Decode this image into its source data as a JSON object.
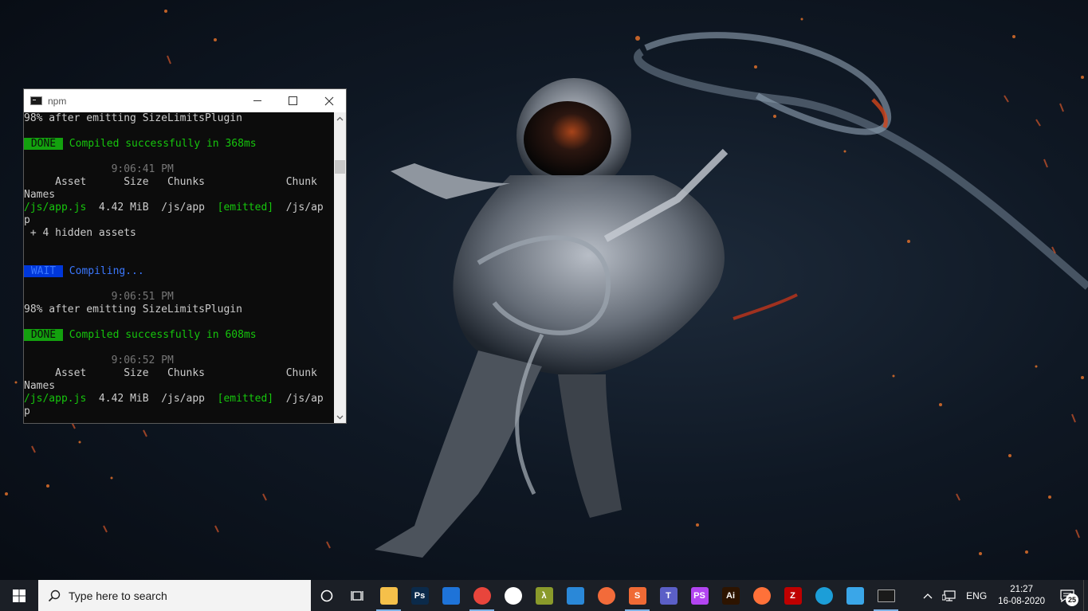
{
  "console_window": {
    "title": "npm",
    "lines": [
      {
        "parts": [
          {
            "text": "98% after emitting SizeLimitsPlugin",
            "cls": ""
          }
        ]
      },
      {
        "parts": []
      },
      {
        "parts": [
          {
            "text": " DONE ",
            "cls": "tag-done"
          },
          {
            "text": " Compiled successfully in 368ms",
            "cls": "green"
          }
        ]
      },
      {
        "parts": []
      },
      {
        "parts": [
          {
            "text": "              9:06:41 PM",
            "cls": "grey"
          }
        ]
      },
      {
        "parts": [
          {
            "text": "     Asset      Size   Chunks             Chunk",
            "cls": ""
          }
        ]
      },
      {
        "parts": [
          {
            "text": "Names",
            "cls": ""
          }
        ]
      },
      {
        "parts": [
          {
            "text": "/js/app.js",
            "cls": "green"
          },
          {
            "text": "  4.42 MiB  /js/app  ",
            "cls": ""
          },
          {
            "text": "[emitted]",
            "cls": "green"
          },
          {
            "text": "  /js/ap",
            "cls": ""
          }
        ]
      },
      {
        "parts": [
          {
            "text": "p",
            "cls": ""
          }
        ]
      },
      {
        "parts": [
          {
            "text": " + 4 hidden assets",
            "cls": ""
          }
        ]
      },
      {
        "parts": []
      },
      {
        "parts": []
      },
      {
        "parts": [
          {
            "text": " WAIT ",
            "cls": "tag-wait"
          },
          {
            "text": " Compiling...",
            "cls": "blue"
          }
        ]
      },
      {
        "parts": []
      },
      {
        "parts": [
          {
            "text": "              9:06:51 PM",
            "cls": "grey"
          }
        ]
      },
      {
        "parts": [
          {
            "text": "98% after emitting SizeLimitsPlugin",
            "cls": ""
          }
        ]
      },
      {
        "parts": []
      },
      {
        "parts": [
          {
            "text": " DONE ",
            "cls": "tag-done"
          },
          {
            "text": " Compiled successfully in 608ms",
            "cls": "green"
          }
        ]
      },
      {
        "parts": []
      },
      {
        "parts": [
          {
            "text": "              9:06:52 PM",
            "cls": "grey"
          }
        ]
      },
      {
        "parts": [
          {
            "text": "     Asset      Size   Chunks             Chunk",
            "cls": ""
          }
        ]
      },
      {
        "parts": [
          {
            "text": "Names",
            "cls": ""
          }
        ]
      },
      {
        "parts": [
          {
            "text": "/js/app.js",
            "cls": "green"
          },
          {
            "text": "  4.42 MiB  /js/app  ",
            "cls": ""
          },
          {
            "text": "[emitted]",
            "cls": "green"
          },
          {
            "text": "  /js/ap",
            "cls": ""
          }
        ]
      },
      {
        "parts": [
          {
            "text": "p",
            "cls": ""
          }
        ]
      }
    ]
  },
  "taskbar": {
    "search_placeholder": "Type here to search",
    "apps": [
      {
        "name": "file-explorer-icon",
        "label": "",
        "color": "#f5c04a",
        "state": "running"
      },
      {
        "name": "photoshop-icon",
        "label": "Ps",
        "color": "#0b2a4a",
        "state": ""
      },
      {
        "name": "mail-icon",
        "label": "",
        "color": "#1e73d8",
        "state": ""
      },
      {
        "name": "chrome-icon",
        "label": "",
        "color": "#e8453c",
        "state": "running"
      },
      {
        "name": "mongodb-compass-icon",
        "label": "",
        "color": "#ffffff",
        "state": ""
      },
      {
        "name": "lambda-icon",
        "label": "λ",
        "color": "#8a9a2b",
        "state": ""
      },
      {
        "name": "vscode-icon",
        "label": "",
        "color": "#2a88d8",
        "state": ""
      },
      {
        "name": "postman-icon",
        "label": "",
        "color": "#f26b3a",
        "state": ""
      },
      {
        "name": "sublime-text-icon",
        "label": "S",
        "color": "#f06a35",
        "state": "running"
      },
      {
        "name": "teams-icon",
        "label": "T",
        "color": "#5b5fc7",
        "state": ""
      },
      {
        "name": "phpstorm-icon",
        "label": "PS",
        "color": "#b345f1",
        "state": ""
      },
      {
        "name": "illustrator-icon",
        "label": "Ai",
        "color": "#2d1400",
        "state": ""
      },
      {
        "name": "firefox-icon",
        "label": "",
        "color": "#ff7139",
        "state": ""
      },
      {
        "name": "filezilla-icon",
        "label": "Z",
        "color": "#bf0000",
        "state": ""
      },
      {
        "name": "edge-icon",
        "label": "",
        "color": "#1c9ed8",
        "state": ""
      },
      {
        "name": "app-icon",
        "label": "",
        "color": "#3aa6e8",
        "state": ""
      },
      {
        "name": "command-prompt-icon",
        "label": "",
        "color": "#1a1a1a",
        "state": "active"
      }
    ],
    "tray": {
      "language": "ENG",
      "time": "21:27",
      "date": "16-08-2020",
      "notification_count": "25"
    }
  }
}
